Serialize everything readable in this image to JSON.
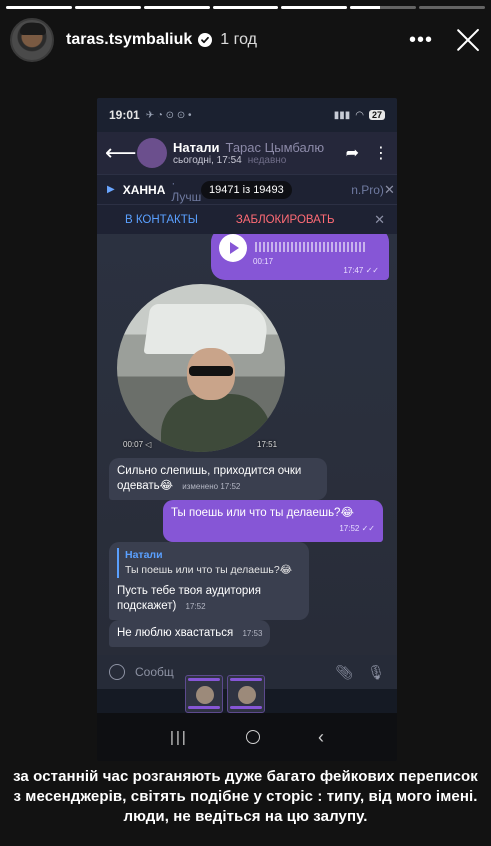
{
  "story": {
    "progress": [
      1,
      1,
      1,
      1,
      1,
      0.45,
      0
    ],
    "username": "taras.tsymbaliuk",
    "time_ago": "1 год"
  },
  "phone": {
    "status_time": "19:01",
    "status_icons": "✈ ◔ ⊙ ⊙ •",
    "battery": "27",
    "chat_title": "Натали",
    "chat_title_ghost": "Тарас Цымбалю",
    "chat_subtitle": "сьогодні, 17:54",
    "chat_subtitle_ghost": "недавно",
    "audio_name": "ХАННА",
    "audio_track": "· Лучш",
    "audio_track_tail": "n.Pro)",
    "audio_counter": "19471 із 19493",
    "add_contact_label": "В КОНТАКТЫ",
    "block_label": "ЗАБЛОКИРОВАТЬ",
    "voice_duration": "00:17",
    "voice_time": "17:47 ✓✓",
    "video_duration": "00:07 ◁",
    "video_time": "17:51",
    "messages": [
      {
        "text": "Сильно слепишь, приходится очки одевать😂",
        "meta": "изменено 17:52"
      },
      {
        "text": "Ты поешь или что ты делаешь?😂",
        "meta": "17:52 ✓✓"
      },
      {
        "reply_name": "Натали",
        "reply_text": "Ты поешь или что ты делаешь?😂",
        "text": "Пусть тебе твоя аудитория подскажет)",
        "meta": "17:52"
      },
      {
        "text": "Не люблю хвастаться",
        "meta": "17:53"
      }
    ],
    "input_placeholder": "Сообщ"
  },
  "caption": "за останній час розганяють дуже багато фейкових переписок з месенджерів, світять подібне у сторіс : типу, від мого імені. люди, не ведіться на цю залупу."
}
